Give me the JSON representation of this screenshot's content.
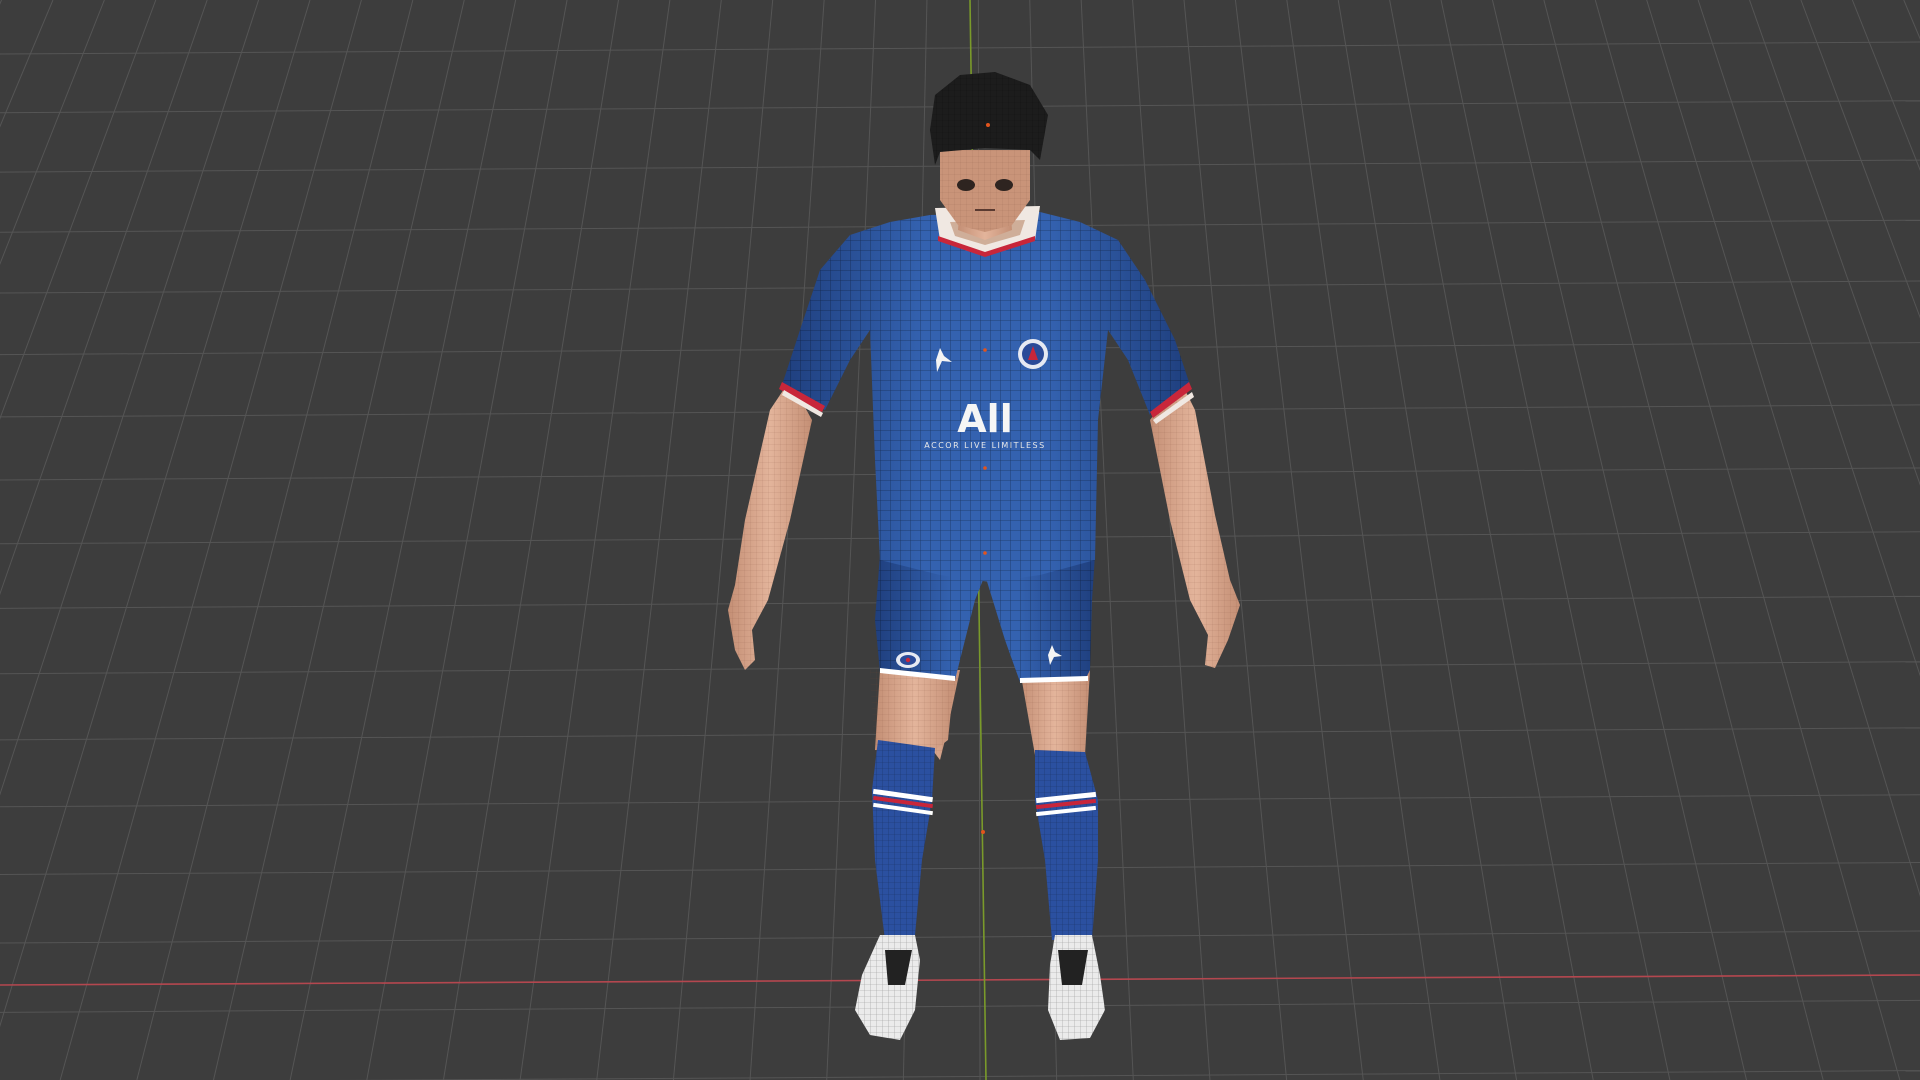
{
  "viewport": {
    "background_color": "#3d3d3d",
    "grid_color": "#555555",
    "axis_x_color": "#b4474f",
    "axis_y_color": "#7a9a2a",
    "shading": "solid with wireframe overlay"
  },
  "model": {
    "jersey": {
      "primary_color": "#2f57a3",
      "dark_color": "#203f7d",
      "trim_color": "#c8263a",
      "collar_color": "#f0e8e2",
      "sponsor_text": "All",
      "sponsor_subtext": "ACCOR LIVE LIMITLESS",
      "left_chest_icon": "jumpman-icon",
      "right_chest_icon": "club-crest-icon"
    },
    "shorts": {
      "primary_color": "#2f57a3",
      "left_icon": "club-crest-icon",
      "right_icon": "jumpman-icon"
    },
    "skin_color": "#d9a98e",
    "hair_color": "#1c1c1c",
    "boot_color": "#ececec",
    "sock_stripe_colors": [
      "#ffffff",
      "#c8263a"
    ]
  }
}
